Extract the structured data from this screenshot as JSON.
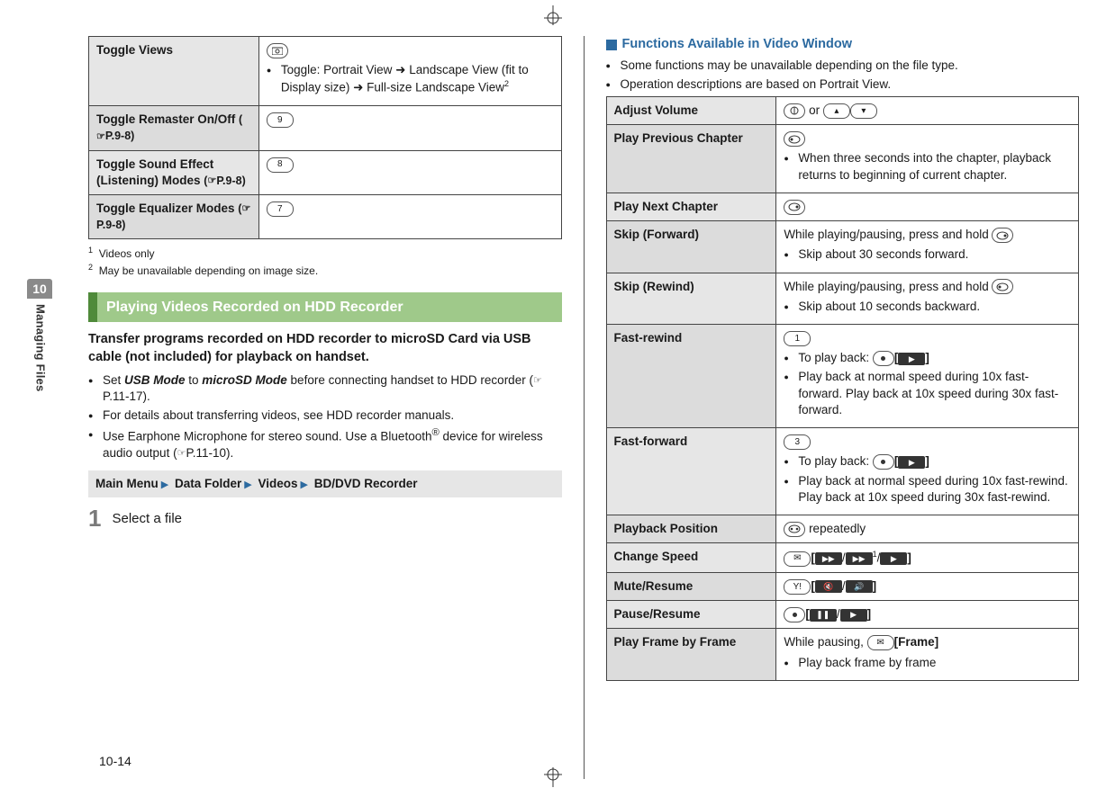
{
  "chapter": {
    "number": "10",
    "label": "Managing Files"
  },
  "page_number": "10-14",
  "left": {
    "table": {
      "rows": [
        {
          "label": "Toggle Views",
          "desc_bullet": "Toggle: Portrait View ➜ Landscape View (fit to Display size) ➜ Full-size Landscape View",
          "desc_sup": "2",
          "icon": "camera"
        },
        {
          "label": "Toggle Remaster On/Off",
          "ref": "P.9-8",
          "key": "9"
        },
        {
          "label": "Toggle Sound Effect (Listening) Modes",
          "ref": "P.9-8",
          "key": "8"
        },
        {
          "label": "Toggle Equalizer Modes",
          "ref": "P.9-8",
          "key": "7"
        }
      ]
    },
    "footnotes": {
      "f1": "Videos only",
      "f2": "May be unavailable depending on image size."
    },
    "section_title": "Playing Videos Recorded on HDD Recorder",
    "lead": "Transfer programs recorded on HDD recorder to microSD Card via USB cable (not included) for playback on handset.",
    "bullets": {
      "b1_pre": "Set ",
      "b1_bold1": "USB Mode",
      "b1_mid": " to ",
      "b1_bold2": "microSD Mode",
      "b1_post": " before connecting handset to HDD recorder (",
      "b1_ref": "P.11-17",
      "b1_close": ").",
      "b2": "For details about transferring videos, see HDD recorder manuals.",
      "b3_pre": "Use Earphone Microphone for stereo sound. Use a Bluetooth",
      "b3_post": " device for wireless audio output (",
      "b3_ref": "P.11-10",
      "b3_close": ")."
    },
    "navpath": {
      "p1": "Main Menu",
      "p2": "Data Folder",
      "p3": "Videos",
      "p4": "BD/DVD Recorder"
    },
    "step": {
      "num": "1",
      "text": "Select a file"
    }
  },
  "right": {
    "subhdr": "Functions Available in Video Window",
    "intro1": "Some functions may be unavailable depending on the file type.",
    "intro2": "Operation descriptions are based on Portrait View.",
    "table": {
      "rows": {
        "adjust_volume": {
          "label": "Adjust Volume",
          "desc": " or "
        },
        "play_prev": {
          "label": "Play Previous Chapter",
          "bullet": "When three seconds into the chapter, playback returns to beginning of current chapter."
        },
        "play_next": {
          "label": "Play Next Chapter"
        },
        "skip_fwd": {
          "label": "Skip (Forward)",
          "lead": "While playing/pausing, press and hold ",
          "bullet": "Skip about 30 seconds forward."
        },
        "skip_rew": {
          "label": "Skip (Rewind)",
          "lead": "While playing/pausing, press and hold ",
          "bullet": "Skip about 10 seconds backward."
        },
        "fast_rew": {
          "label": "Fast-rewind",
          "key": "1",
          "tp": "To play back: ",
          "bullet": "Play back at normal speed during 10x fast-forward. Play back at 10x speed during 30x fast-forward."
        },
        "fast_fwd": {
          "label": "Fast-forward",
          "key": "3",
          "tp": "To play back: ",
          "bullet": "Play back at normal speed during 10x fast-rewind. Play back at 10x speed during 30x fast-rewind."
        },
        "playback_pos": {
          "label": "Playback Position",
          "desc": " repeatedly"
        },
        "change_speed": {
          "label": "Change Speed"
        },
        "mute": {
          "label": "Mute/Resume"
        },
        "pause": {
          "label": "Pause/Resume"
        },
        "frame": {
          "label": "Play Frame by Frame",
          "lead": "While pausing, ",
          "btn": "[Frame]",
          "bullet": "Play back frame by frame"
        }
      }
    }
  }
}
